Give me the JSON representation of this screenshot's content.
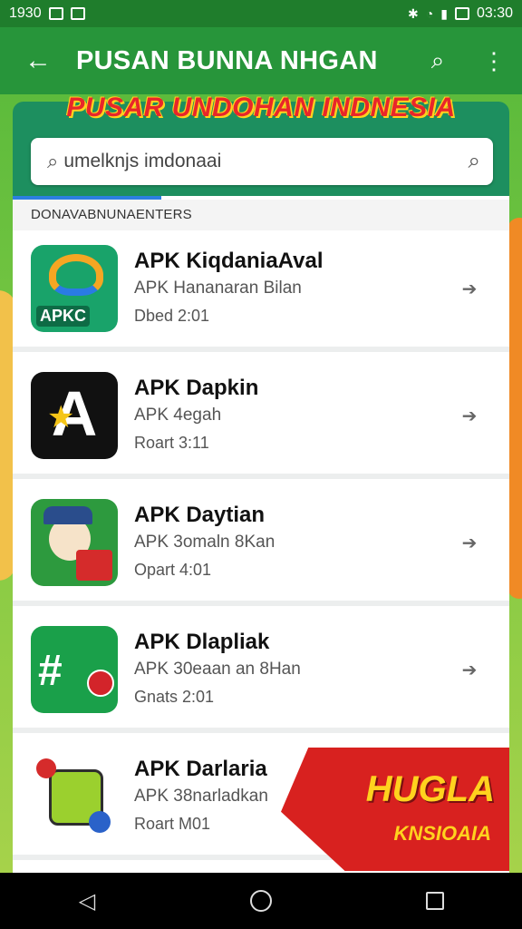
{
  "status_bar": {
    "time_left": "1930",
    "time_right": "03:30",
    "icons": [
      "notification-icon",
      "mail-icon",
      "bluetooth-icon",
      "wifi-icon",
      "signal-icon",
      "battery-icon"
    ]
  },
  "app_bar": {
    "back_icon": "arrow-left-icon",
    "title": "PUSAN BUNNA NHGAN",
    "search_icon": "search-icon",
    "more_icon": "more-vert-icon"
  },
  "banner": {
    "title": "PUSAR UNDOHAN INDNESIA"
  },
  "search": {
    "value": "umelknjs imdonaai"
  },
  "list": {
    "section_header": "DONAVABNUNAENTERS",
    "items": [
      {
        "name": "APK KiqdaniaAval",
        "sub": "APK Hananaran Bilan",
        "meta": "Dbed 2:01"
      },
      {
        "name": "APK Dapkin",
        "sub": "APK 4egah",
        "meta": "Roart 3:11"
      },
      {
        "name": "APK Daytian",
        "sub": "APK 3omaln 8Kan",
        "meta": "Opart 4:01"
      },
      {
        "name": "APK Dlapliak",
        "sub": "APK 30eaan an 8Han",
        "meta": "Gnats 2:01"
      },
      {
        "name": "APK Darlaria",
        "sub": "APK 38narladkan",
        "meta": "Roart M01"
      }
    ],
    "icon_tile_1_label": "APKC",
    "icon_tile_2_glyph": "A",
    "icon_tile_4_glyph": "#"
  },
  "promo": {
    "line1": "HUGLA",
    "line2": "KNSIOAIA"
  },
  "colors": {
    "status_bar": "#1f7d2c",
    "app_bar": "#27953a",
    "header_card": "#1d8f5f",
    "accent_tab": "#2b7fe0",
    "banner_red": "#e8262a",
    "promo_red": "#d8211f"
  }
}
